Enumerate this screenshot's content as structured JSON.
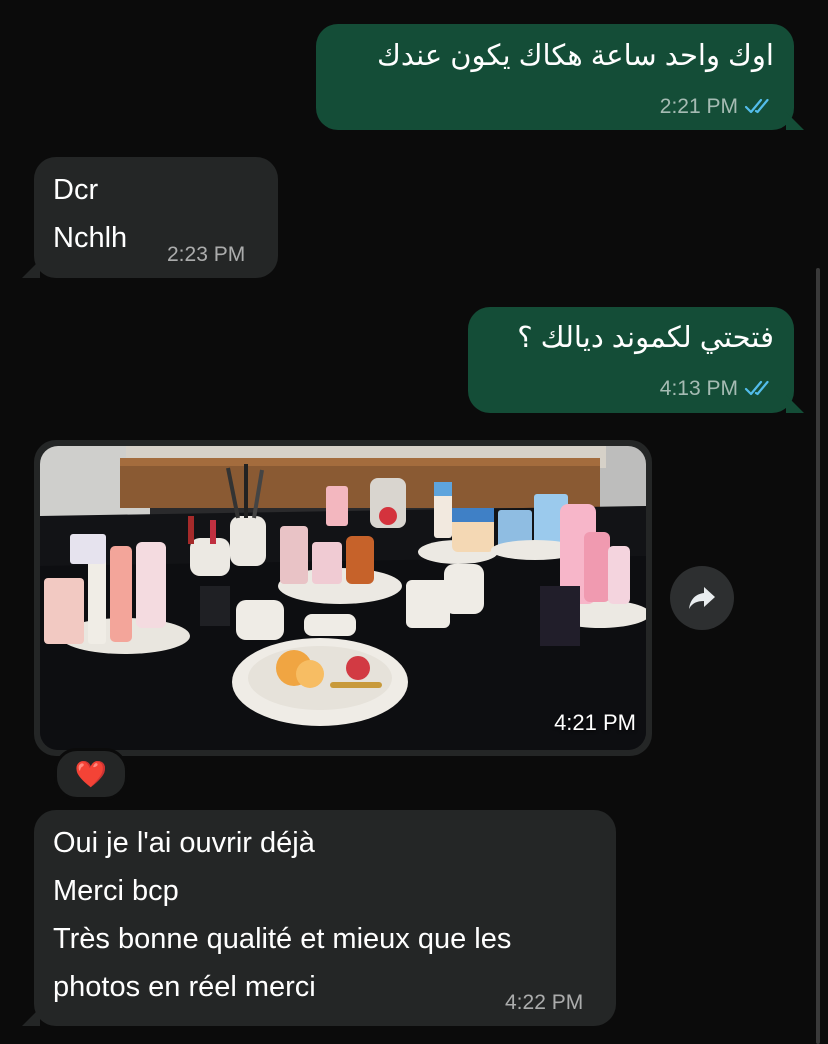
{
  "messages": {
    "m1": {
      "text": "اوك واحد ساعة هكاك يكون عندك",
      "time": "2:21 PM",
      "status": "read"
    },
    "m2": {
      "lines": [
        "Dcr",
        "Nchlh"
      ],
      "time": "2:23 PM"
    },
    "m3": {
      "text": "فتحتي لكموند ديالك ؟",
      "time": "4:13 PM",
      "status": "read"
    },
    "m4": {
      "type": "photo",
      "time": "4:21 PM",
      "reaction": "❤️"
    },
    "m5": {
      "lines": [
        "Oui je l'ai ouvrir déjà",
        "Merci bcp",
        "Très bonne qualité et mieux que les",
        "photos en réel merci"
      ],
      "time": "4:22 PM"
    }
  },
  "icons": {
    "read_receipt": "double-check-icon",
    "forward": "forward-arrow-icon",
    "reaction": "heart-icon"
  },
  "colors": {
    "outgoing": "#144d37",
    "incoming": "#242626",
    "background": "#0b0b0b",
    "read_tick": "#53bdeb"
  }
}
